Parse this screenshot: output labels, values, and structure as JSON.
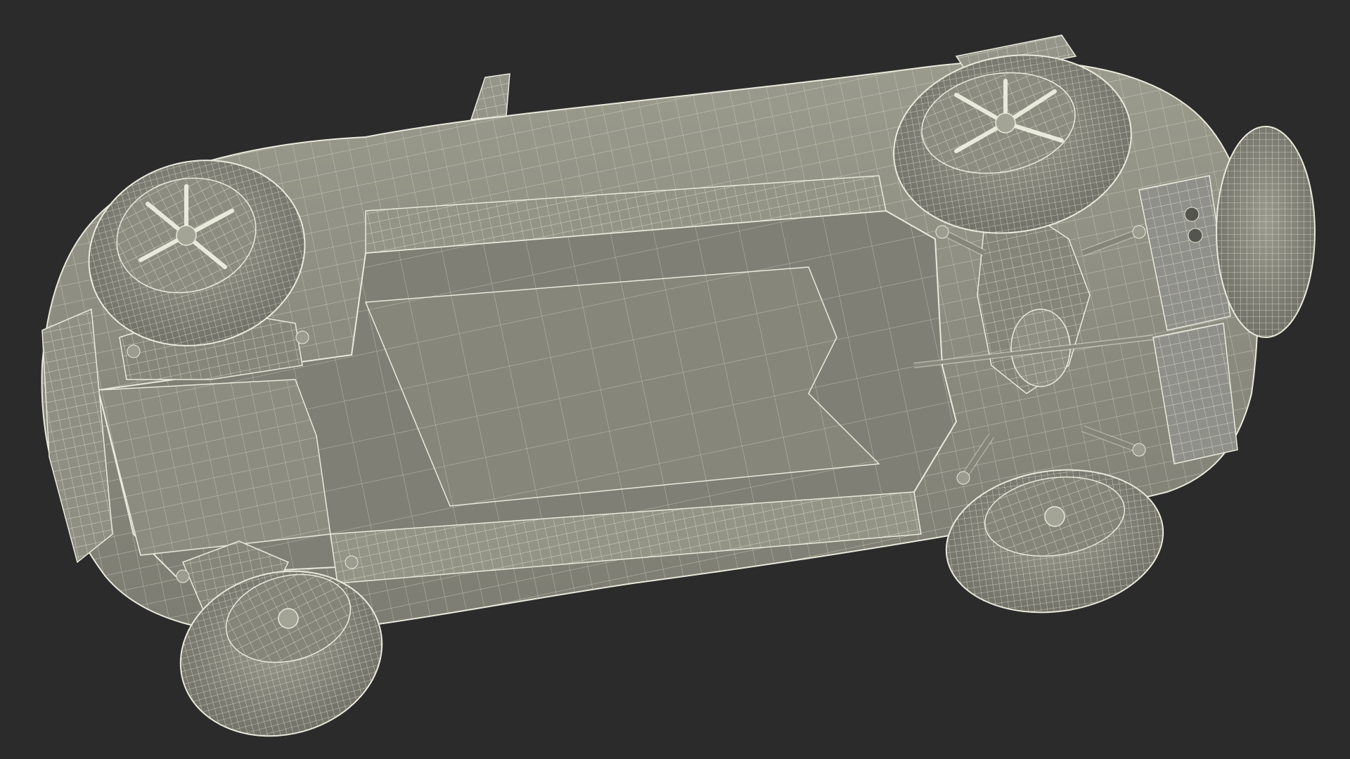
{
  "scene": {
    "background_color": "#2b2b2b",
    "mesh_fill_color": "#8a8a7f",
    "mesh_shadow_color": "#6c6c63",
    "mesh_highlight_color": "#a3a396",
    "wire_color": "#e9e9dc",
    "subject": "car-underside-wireframe",
    "rendered_text": []
  }
}
